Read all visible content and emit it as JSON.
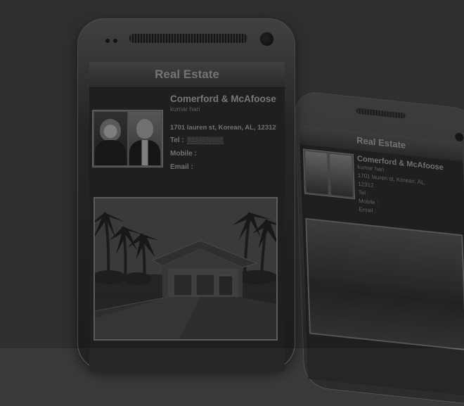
{
  "app": {
    "title": "Real Estate"
  },
  "agent": {
    "company": "Comerford & McAfoose",
    "name": "kumar hari",
    "address": "1701 lauren st, Korean, AL, 12312",
    "tel_label": "Tel :",
    "tel_value": "9234570002",
    "mobile_label": "Mobile :",
    "email_label": "Email :"
  },
  "back_phone": {
    "title": "Real Estate",
    "company": "Comerford & McAfoose",
    "name": "kumar hari",
    "address_line1": "1701 lauren st, Korean, AL,",
    "address_line2": "12312",
    "tel_label": "Tel :",
    "mobile_label": "Mobile :",
    "email_label": "Email :"
  },
  "icons": {
    "front_camera": "camera-icon",
    "speaker": "speaker-icon"
  },
  "colors": {
    "background": "#3a3a3a",
    "screen": "#272727",
    "title_bar": "#404040"
  }
}
